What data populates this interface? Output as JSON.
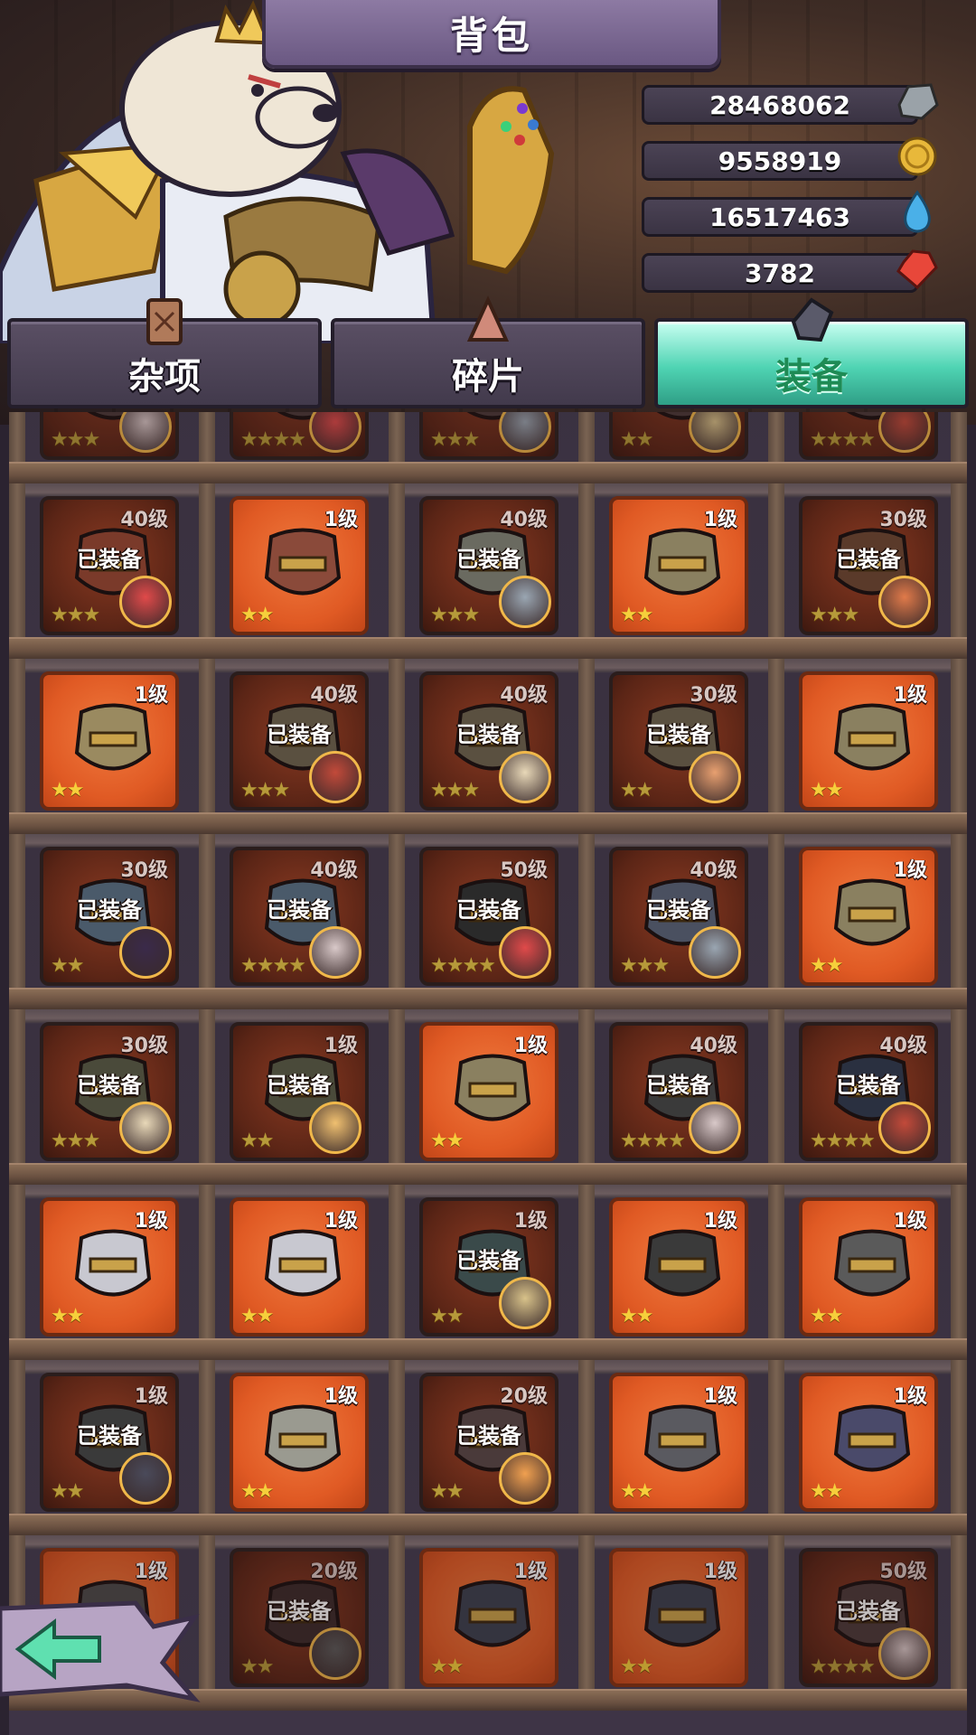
{
  "header": {
    "title": "背包"
  },
  "currencies": [
    {
      "value": "28468062",
      "icon": "stone-icon"
    },
    {
      "value": "9558919",
      "icon": "gold-coin-icon"
    },
    {
      "value": "16517463",
      "icon": "water-drop-icon"
    },
    {
      "value": "3782",
      "icon": "red-gem-icon"
    }
  ],
  "tabs": [
    {
      "label": "杂项",
      "active": false
    },
    {
      "label": "碎片",
      "active": false
    },
    {
      "label": "装备",
      "active": true
    }
  ],
  "equipped_text": "已装备",
  "colors": {
    "active_tab": "#4fd4b3",
    "new_item_bg": "#e05a24",
    "owned_item_bg": "#5b2516",
    "star": "#f6cf3b"
  },
  "grid": [
    [
      {
        "level": "",
        "equipped": true,
        "stars": 3,
        "avatar": "#d9c9c9"
      },
      {
        "level": "",
        "equipped": true,
        "stars": 4,
        "avatar": "#e04a4a"
      },
      {
        "level": "",
        "equipped": true,
        "stars": 3,
        "avatar": "#9aa6b2"
      },
      {
        "level": "",
        "equipped": true,
        "stars": 2,
        "avatar": "#d8c28a"
      },
      {
        "level": "",
        "equipped": true,
        "stars": 4,
        "avatar": "#c24a3a"
      }
    ],
    [
      {
        "level": "40级",
        "equipped": true,
        "stars": 3,
        "avatar": "#e04a4a",
        "item": "#7a3a2a"
      },
      {
        "level": "1级",
        "equipped": false,
        "stars": 2,
        "item": "#8a4a3a"
      },
      {
        "level": "40级",
        "equipped": true,
        "stars": 3,
        "avatar": "#9aa6b2",
        "item": "#6a6a60"
      },
      {
        "level": "1级",
        "equipped": false,
        "stars": 2,
        "item": "#8a8060"
      },
      {
        "level": "30级",
        "equipped": true,
        "stars": 3,
        "avatar": "#e07a4a",
        "item": "#5a3a2a"
      }
    ],
    [
      {
        "level": "1级",
        "equipped": false,
        "stars": 2,
        "item": "#9a8a60"
      },
      {
        "level": "40级",
        "equipped": true,
        "stars": 3,
        "avatar": "#c24a3a",
        "item": "#5a5040"
      },
      {
        "level": "40级",
        "equipped": true,
        "stars": 3,
        "avatar": "#e8d8b8",
        "item": "#5a5040"
      },
      {
        "level": "30级",
        "equipped": true,
        "stars": 2,
        "avatar": "#e8a070",
        "item": "#5a5040"
      },
      {
        "level": "1级",
        "equipped": false,
        "stars": 2,
        "item": "#8a8060"
      }
    ],
    [
      {
        "level": "30级",
        "equipped": true,
        "stars": 2,
        "avatar": "#3a2a4a",
        "item": "#4a5a6a"
      },
      {
        "level": "40级",
        "equipped": true,
        "stars": 4,
        "avatar": "#d9c9c9",
        "item": "#4a5a6a"
      },
      {
        "level": "50级",
        "equipped": true,
        "stars": 4,
        "avatar": "#e04a4a",
        "item": "#2a2a2a"
      },
      {
        "level": "40级",
        "equipped": true,
        "stars": 3,
        "avatar": "#9aa6b2",
        "item": "#4a5060"
      },
      {
        "level": "1级",
        "equipped": false,
        "stars": 2,
        "item": "#8a8060"
      }
    ],
    [
      {
        "level": "30级",
        "equipped": true,
        "stars": 3,
        "avatar": "#e8d8b8",
        "item": "#4a4a3a"
      },
      {
        "level": "1级",
        "equipped": true,
        "stars": 2,
        "avatar": "#f0c070",
        "item": "#4a4a3a"
      },
      {
        "level": "1级",
        "equipped": false,
        "stars": 2,
        "item": "#8a8060"
      },
      {
        "level": "40级",
        "equipped": true,
        "stars": 4,
        "avatar": "#d9c9c9",
        "item": "#3a3a3a"
      },
      {
        "level": "40级",
        "equipped": true,
        "stars": 4,
        "avatar": "#c24a3a",
        "item": "#2a3040"
      }
    ],
    [
      {
        "level": "1级",
        "equipped": false,
        "stars": 2,
        "item": "#c8c8d0"
      },
      {
        "level": "1级",
        "equipped": false,
        "stars": 2,
        "item": "#c8c8d0"
      },
      {
        "level": "1级",
        "equipped": true,
        "stars": 2,
        "avatar": "#d8c28a",
        "item": "#3a4a4a"
      },
      {
        "level": "1级",
        "equipped": false,
        "stars": 2,
        "item": "#3a3a3a"
      },
      {
        "level": "1级",
        "equipped": false,
        "stars": 2,
        "item": "#5a5a5a"
      }
    ],
    [
      {
        "level": "1级",
        "equipped": true,
        "stars": 2,
        "avatar": "#4a4a5a",
        "item": "#3a3a3a"
      },
      {
        "level": "1级",
        "equipped": false,
        "stars": 2,
        "item": "#9a9a90"
      },
      {
        "level": "20级",
        "equipped": true,
        "stars": 2,
        "avatar": "#f0a050",
        "item": "#4a3a3a"
      },
      {
        "level": "1级",
        "equipped": false,
        "stars": 2,
        "item": "#5a5a60"
      },
      {
        "level": "1级",
        "equipped": false,
        "stars": 2,
        "item": "#4a4a6a"
      }
    ],
    [
      {
        "level": "1级",
        "equipped": false,
        "stars": 3,
        "item": "#4a4a4a"
      },
      {
        "level": "20级",
        "equipped": true,
        "stars": 2,
        "avatar": "#5a5a5a",
        "item": "#3a2a2a"
      },
      {
        "level": "1级",
        "equipped": false,
        "stars": 2,
        "item": "#3a4050"
      },
      {
        "level": "1级",
        "equipped": false,
        "stars": 2,
        "item": "#3a4050"
      },
      {
        "level": "50级",
        "equipped": true,
        "stars": 4,
        "avatar": "#d9c9c9",
        "item": "#4a3a3a"
      }
    ]
  ]
}
